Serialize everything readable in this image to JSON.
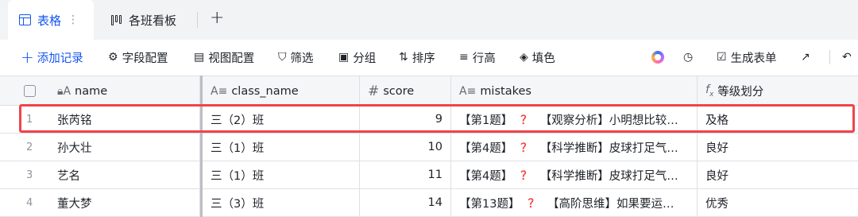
{
  "tabs": {
    "active_label": "表格",
    "dots": "⋮",
    "second_label": "各班看板",
    "add": "+"
  },
  "toolbar": {
    "add_record": "添加记录",
    "field_config": "字段配置",
    "view_config": "视图配置",
    "filter": "筛选",
    "group": "分组",
    "sort": "排序",
    "row_height": "行高",
    "fill_color": "填色",
    "generate_form": "生成表单"
  },
  "columns": {
    "name": "name",
    "class_name": "class_name",
    "score": "score",
    "mistakes": "mistakes",
    "grade": "等级划分"
  },
  "column_icons": {
    "name": "lock-text-icon",
    "class_name": "text-icon",
    "score": "number-icon",
    "mistakes": "text-icon",
    "grade": "formula-icon"
  },
  "rows": [
    {
      "index": "1",
      "name": "张芮铭",
      "class_name": "三（2）班",
      "score": "9",
      "mistake_q": "【第1题】",
      "mistake_q2": "？",
      "mistake_text": "【观察分析】小明想比较…",
      "grade": "及格"
    },
    {
      "index": "2",
      "name": "孙大壮",
      "class_name": "三（1）班",
      "score": "10",
      "mistake_q": "【第4题】",
      "mistake_q2": "？",
      "mistake_text": "【科学推断】皮球打足气…",
      "grade": "良好"
    },
    {
      "index": "3",
      "name": "艺名",
      "class_name": "三（1）班",
      "score": "11",
      "mistake_q": "【第4题】",
      "mistake_q2": "？",
      "mistake_text": "【科学推断】皮球打足气…",
      "grade": "良好"
    },
    {
      "index": "4",
      "name": "董大梦",
      "class_name": "三（3）班",
      "score": "14",
      "mistake_q": "【第13题】",
      "mistake_q2": "？",
      "mistake_text": "【高阶思维】如果要运…",
      "grade": "优秀"
    }
  ],
  "colors": {
    "accent": "#1456f0",
    "highlight_border": "#f0444a",
    "question_mark": "#f54a45"
  }
}
